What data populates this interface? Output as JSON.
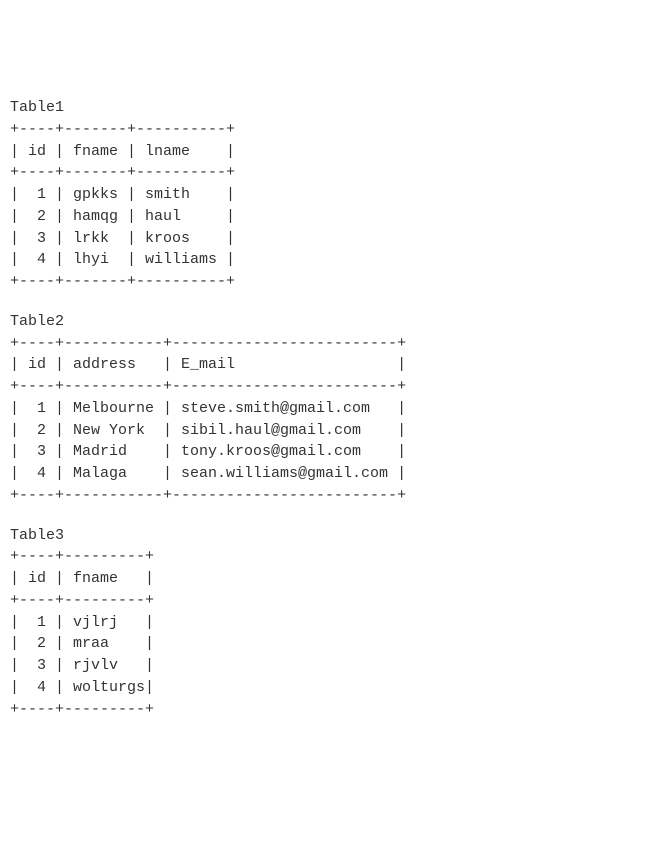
{
  "tables": [
    {
      "title": "Table1",
      "columns": [
        {
          "name": "id",
          "width": 4,
          "align": "right"
        },
        {
          "name": "fname",
          "width": 7,
          "align": "left"
        },
        {
          "name": "lname",
          "width": 10,
          "align": "left"
        }
      ],
      "rows": [
        {
          "id": "1",
          "fname": "gpkks",
          "lname": "smith"
        },
        {
          "id": "2",
          "fname": "hamqg",
          "lname": "haul"
        },
        {
          "id": "3",
          "fname": "lrkk",
          "lname": "kroos"
        },
        {
          "id": "4",
          "fname": "lhyi",
          "lname": "williams"
        }
      ]
    },
    {
      "title": "Table2",
      "columns": [
        {
          "name": "id",
          "width": 4,
          "align": "right"
        },
        {
          "name": "address",
          "width": 11,
          "align": "left"
        },
        {
          "name": "E_mail",
          "width": 25,
          "align": "left"
        }
      ],
      "rows": [
        {
          "id": "1",
          "address": "Melbourne",
          "E_mail": "steve.smith@gmail.com"
        },
        {
          "id": "2",
          "address": "New York",
          "E_mail": "sibil.haul@gmail.com"
        },
        {
          "id": "3",
          "address": "Madrid",
          "E_mail": "tony.kroos@gmail.com"
        },
        {
          "id": "4",
          "address": "Malaga",
          "E_mail": "sean.williams@gmail.com"
        }
      ]
    },
    {
      "title": "Table3",
      "columns": [
        {
          "name": "id",
          "width": 4,
          "align": "right"
        },
        {
          "name": "fname",
          "width": 9,
          "align": "left"
        }
      ],
      "rows": [
        {
          "id": "1",
          "fname": "vjlrj"
        },
        {
          "id": "2",
          "fname": "mraa"
        },
        {
          "id": "3",
          "fname": "rjvlv"
        },
        {
          "id": "4",
          "fname": "wolturgs"
        }
      ]
    }
  ]
}
